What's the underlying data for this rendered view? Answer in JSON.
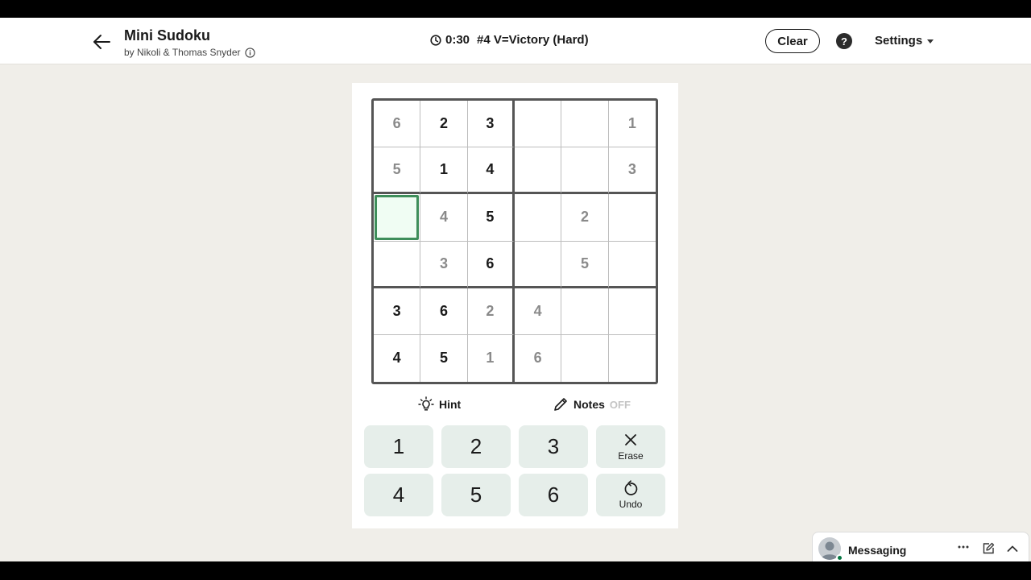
{
  "header": {
    "title": "Mini Sudoku",
    "byline": "by Nikoli & Thomas Snyder",
    "timer": "0:30",
    "puzzle_name": "#4 V=Victory (Hard)",
    "clear_label": "Clear",
    "help_label": "?",
    "settings_label": "Settings"
  },
  "grid": {
    "rows": [
      [
        "6",
        "2",
        "3",
        "",
        "",
        "1"
      ],
      [
        "5",
        "1",
        "4",
        "",
        "",
        "3"
      ],
      [
        "",
        "4",
        "5",
        "",
        "2",
        ""
      ],
      [
        "",
        "3",
        "6",
        "",
        "5",
        ""
      ],
      [
        "3",
        "6",
        "2",
        "4",
        "",
        ""
      ],
      [
        "4",
        "5",
        "1",
        "6",
        "",
        ""
      ]
    ],
    "given": [
      [
        true,
        false,
        false,
        false,
        false,
        true
      ],
      [
        true,
        false,
        false,
        false,
        false,
        true
      ],
      [
        false,
        true,
        false,
        false,
        true,
        false
      ],
      [
        false,
        true,
        false,
        false,
        true,
        false
      ],
      [
        false,
        false,
        true,
        true,
        false,
        false
      ],
      [
        false,
        false,
        true,
        true,
        false,
        false
      ]
    ],
    "selected": {
      "row": 2,
      "col": 0
    }
  },
  "tools": {
    "hint_label": "Hint",
    "notes_label": "Notes",
    "notes_state": "OFF"
  },
  "keypad": {
    "k1": "1",
    "k2": "2",
    "k3": "3",
    "k4": "4",
    "k5": "5",
    "k6": "6",
    "erase_label": "Erase",
    "undo_label": "Undo"
  },
  "messaging": {
    "title": "Messaging"
  },
  "colors": {
    "selected_border": "#3e8e5a",
    "selected_fill": "#f0fdf3",
    "key_bg": "#e6eeea",
    "page_bg": "#f0eee9",
    "online": "#057642"
  }
}
